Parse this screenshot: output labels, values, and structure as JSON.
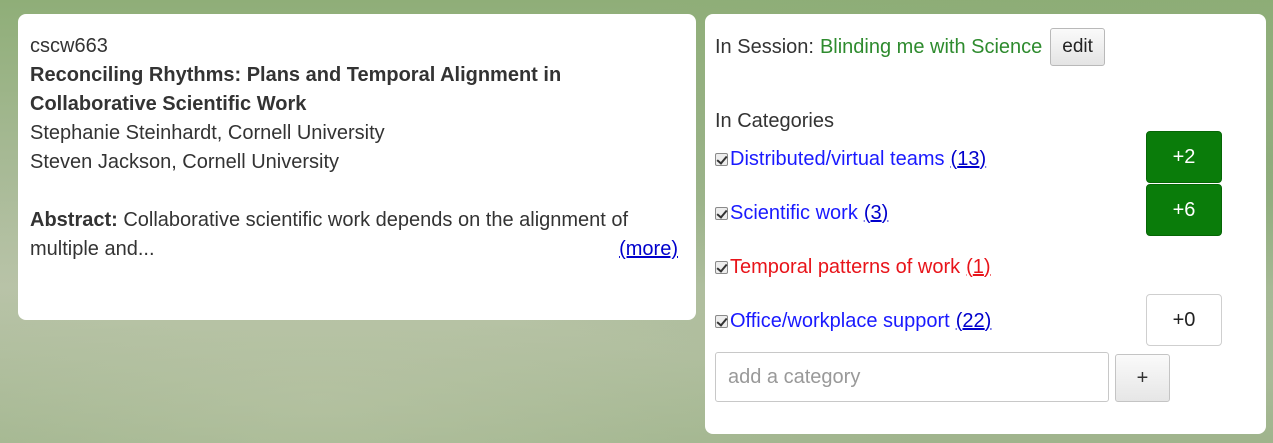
{
  "paper": {
    "id": "cscw663",
    "title": "Reconciling Rhythms: Plans and Temporal Alignment in Collaborative Scientific Work",
    "authors": [
      "Stephanie Steinhardt, Cornell University",
      "Steven Jackson, Cornell University"
    ],
    "abstract_label": "Abstract:",
    "abstract_text": " Collaborative scientific work depends on the alignment of multiple and...",
    "more_label": "(more)"
  },
  "session": {
    "label": "In Session:",
    "name": "Blinding me with Science",
    "edit_label": "edit"
  },
  "categories": {
    "heading": "In Categories",
    "items": [
      {
        "label": "Distributed/virtual teams",
        "count": "13",
        "vote": "+2",
        "checked": true,
        "color": "#1a1aff"
      },
      {
        "label": "Scientific work",
        "count": "3",
        "vote": "+6",
        "checked": true,
        "color": "#1a1aff"
      },
      {
        "label": "Temporal patterns of work",
        "count": "1",
        "vote": "",
        "checked": true,
        "color": "#e8141a"
      },
      {
        "label": "Office/workplace support",
        "count": "22",
        "vote": "+0",
        "checked": true,
        "color": "#1a1aff"
      }
    ],
    "add_placeholder": "add a category",
    "add_button_label": "+"
  },
  "colors": {
    "session_name": "#2e8b2e",
    "vote_green": "#0a7c0a",
    "link_blue": "#1a1aff",
    "link_red": "#e8141a"
  }
}
